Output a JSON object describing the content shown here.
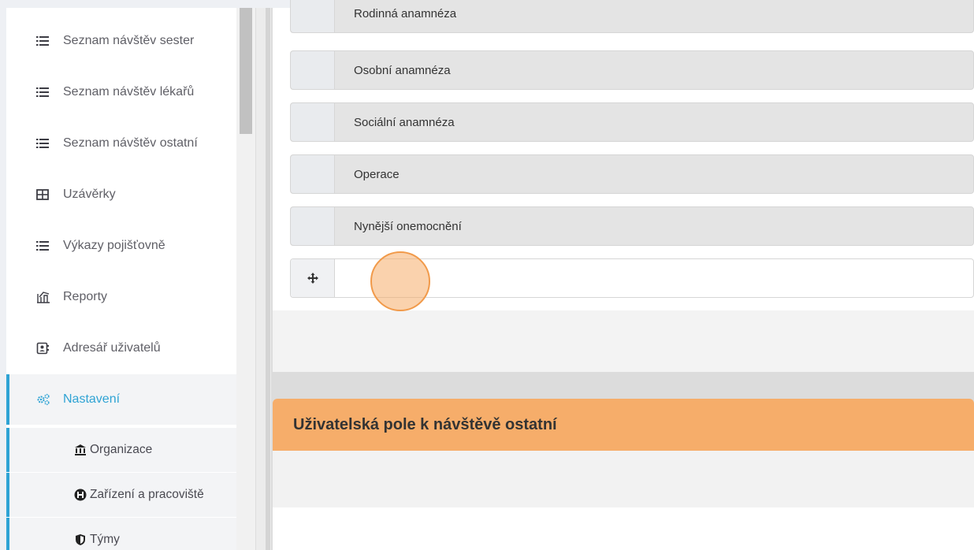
{
  "sidebar": {
    "items": [
      {
        "label": "Seznam návštěv sester",
        "icon": "list-icon"
      },
      {
        "label": "Seznam návštěv lékařů",
        "icon": "list-icon"
      },
      {
        "label": "Seznam návštěv ostatní",
        "icon": "list-icon"
      },
      {
        "label": "Uzávěrky",
        "icon": "table-icon"
      },
      {
        "label": "Výkazy pojišťovně",
        "icon": "list-icon"
      },
      {
        "label": "Reporty",
        "icon": "report-icon"
      },
      {
        "label": "Adresář uživatelů",
        "icon": "contacts-icon"
      },
      {
        "label": "Nastavení",
        "icon": "cogs-icon"
      }
    ],
    "subitems": [
      {
        "label": "Organizace",
        "icon": "bank-icon"
      },
      {
        "label": "Zařízení a pracoviště",
        "icon": "hospital-icon"
      },
      {
        "label": "Týmy",
        "icon": "shield-icon"
      }
    ]
  },
  "fields_list": {
    "rows": [
      {
        "label": "Rodinná anamnéza"
      },
      {
        "label": "Osobní anamnéza"
      },
      {
        "label": "Sociální anamnéza"
      },
      {
        "label": "Operace"
      },
      {
        "label": "Nynější onemocnění"
      },
      {
        "label": "",
        "icon": "move-icon"
      }
    ]
  },
  "other_visit_card": {
    "title": "Uživatelská pole k návštěvě ostatní"
  },
  "colors": {
    "accent": "#2fa3d4",
    "card_header": "#f6ad6a",
    "click_indicator": "#f19a4a"
  }
}
